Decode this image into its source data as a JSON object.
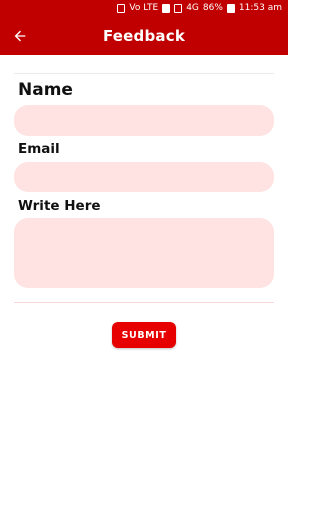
{
  "status_bar": {
    "network_text": "Vo LTE",
    "signal_text": "4G",
    "battery": "86%",
    "time": "11:53 am"
  },
  "app_bar": {
    "title": "Feedback",
    "back_icon": "arrow-left-icon"
  },
  "form": {
    "name_label": "Name",
    "email_label": "Email",
    "write_label": "Write Here",
    "name_value": "",
    "email_value": "",
    "write_value": ""
  },
  "submit_label": "SUBMIT",
  "colors": {
    "primary": "#c00000",
    "button": "#e60000",
    "field_bg": "#ffe3e3"
  }
}
